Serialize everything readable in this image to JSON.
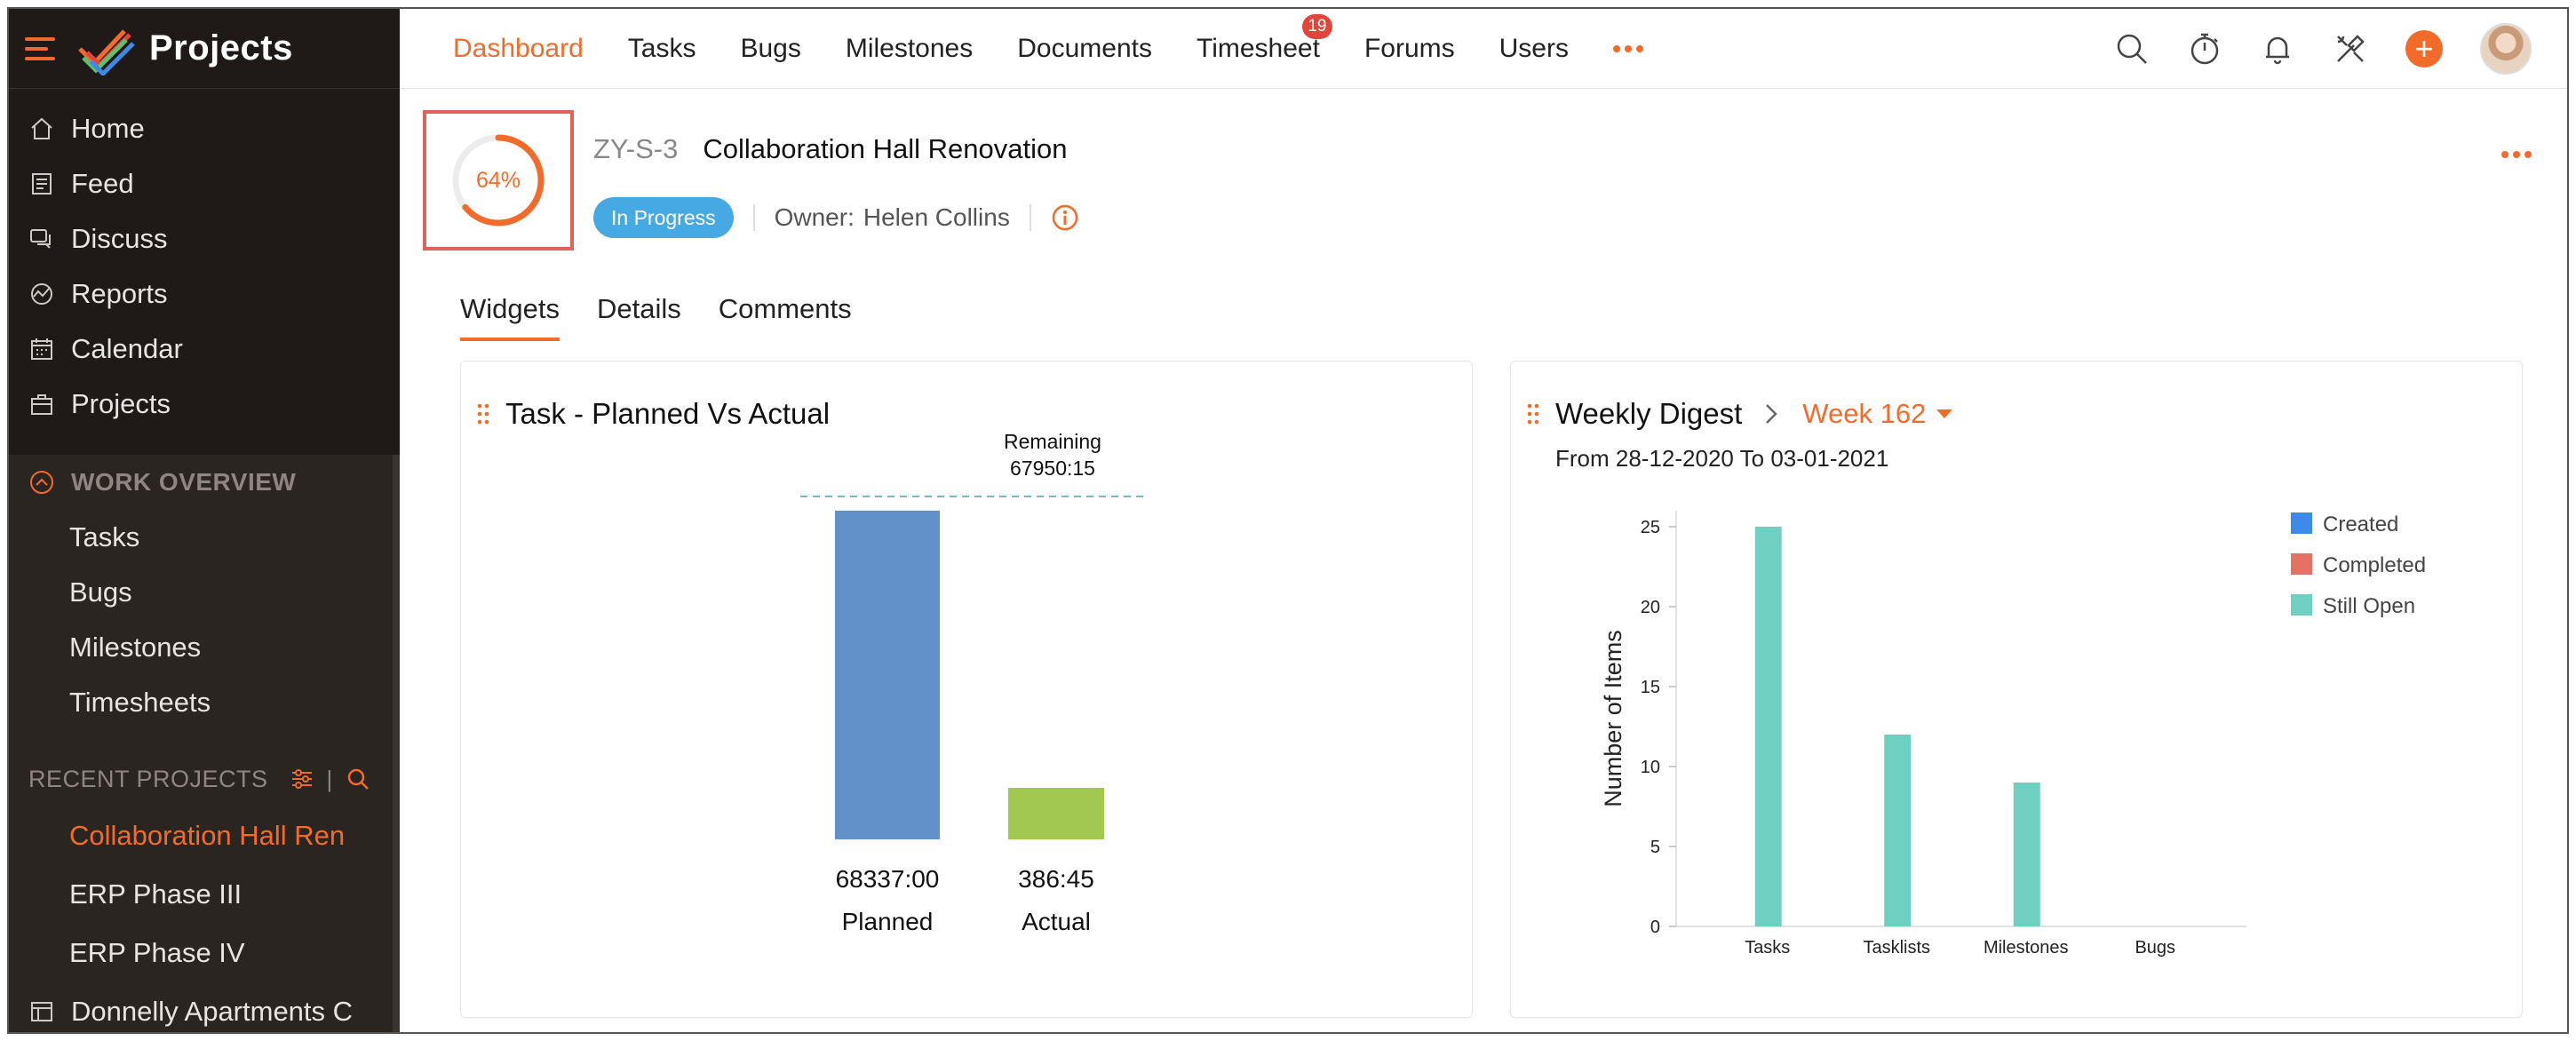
{
  "app": {
    "name": "Projects"
  },
  "sidebar": {
    "items": [
      {
        "label": "Home",
        "icon": "home-icon"
      },
      {
        "label": "Feed",
        "icon": "feed-icon"
      },
      {
        "label": "Discuss",
        "icon": "discuss-icon"
      },
      {
        "label": "Reports",
        "icon": "reports-icon"
      },
      {
        "label": "Calendar",
        "icon": "calendar-icon"
      },
      {
        "label": "Projects",
        "icon": "projects-icon"
      }
    ],
    "work_overview": {
      "title": "WORK OVERVIEW",
      "items": [
        "Tasks",
        "Bugs",
        "Milestones",
        "Timesheets"
      ]
    },
    "recent_projects": {
      "title": "RECENT PROJECTS",
      "items": [
        "Collaboration Hall Ren",
        "ERP Phase III",
        "ERP Phase IV",
        "Donnelly Apartments C"
      ]
    }
  },
  "topbar": {
    "tabs": [
      "Dashboard",
      "Tasks",
      "Bugs",
      "Milestones",
      "Documents",
      "Timesheet",
      "Forums",
      "Users"
    ],
    "timesheet_badge": "19"
  },
  "project": {
    "progress_percent": 64,
    "progress_label": "64%",
    "id": "ZY-S-3",
    "title": "Collaboration Hall Renovation",
    "status": "In Progress",
    "owner_label": "Owner:",
    "owner_name": "Helen Collins"
  },
  "tabs": [
    "Widgets",
    "Details",
    "Comments"
  ],
  "colors": {
    "accent": "#f26b2b",
    "status_blue": "#47a9e4",
    "planned_bar": "#6290c8",
    "actual_bar": "#a2c852",
    "created": "#3d8ae8",
    "completed": "#e47264",
    "still_open": "#6fd0c2"
  },
  "task_widget": {
    "title": "Task - Planned Vs Actual"
  },
  "digest_widget": {
    "title": "Weekly Digest",
    "week": "Week 162",
    "range": "From 28-12-2020 To 03-01-2021"
  },
  "chart_data": [
    {
      "type": "bar",
      "categories": [
        "Planned",
        "Actual"
      ],
      "values": [
        68337,
        386.75
      ],
      "value_labels": [
        "68337:00",
        "386:45"
      ],
      "annotation": {
        "label": "Remaining",
        "value": "67950:15"
      },
      "ylim": [
        0,
        72000
      ]
    },
    {
      "type": "bar",
      "categories": [
        "Tasks",
        "Tasklists",
        "Milestones",
        "Bugs"
      ],
      "series": [
        {
          "name": "Created",
          "values": [
            0,
            0,
            0,
            0
          ]
        },
        {
          "name": "Completed",
          "values": [
            0,
            0,
            0,
            0
          ]
        },
        {
          "name": "Still Open",
          "values": [
            25,
            12,
            9,
            0
          ]
        }
      ],
      "ylabel": "Number of Items",
      "ylim": [
        0,
        26
      ],
      "yticks": [
        0,
        5,
        10,
        15,
        20,
        25
      ],
      "legend_position": "top-right"
    }
  ]
}
